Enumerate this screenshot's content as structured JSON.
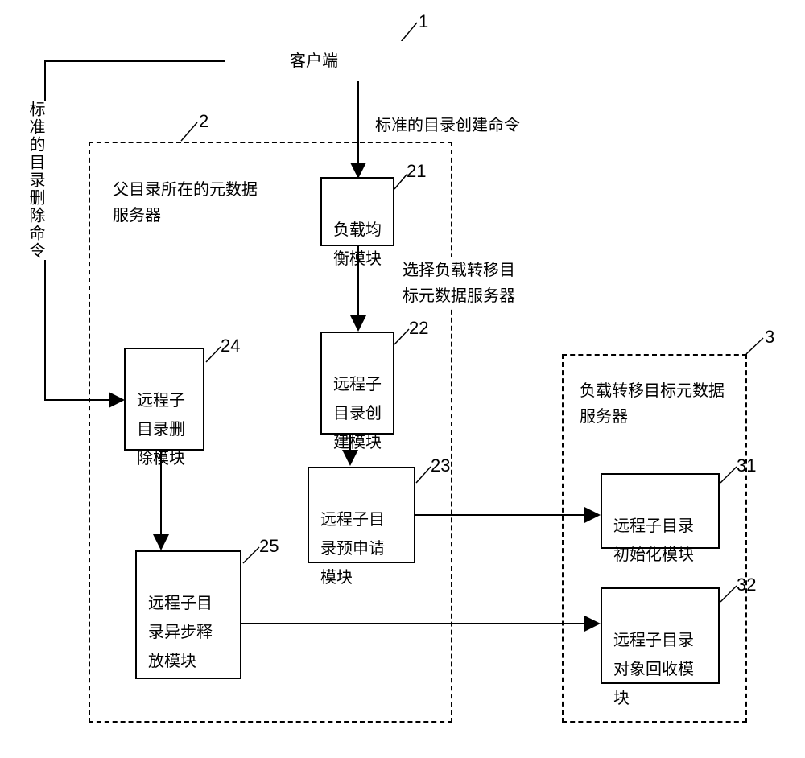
{
  "nodes": {
    "client": "客户端",
    "loadBalance": "负载均\n衡模块",
    "remoteCreate": "远程子\n目录创\n建模块",
    "remoteDelete": "远程子\n目录删\n除模块",
    "remotePreApply": "远程子目\n录预申请\n模块",
    "remoteAsyncRelease": "远程子目\n录异步释\n放模块",
    "remoteInit": "远程子目录\n初始化模块",
    "remoteRecycle": "远程子目录\n对象回收模\n块"
  },
  "containers": {
    "parentMetaServer": "父目录所在的元数据\n服务器",
    "targetMetaServer": "负载转移目标元数据\n服务器"
  },
  "edgeLabels": {
    "createCmd": "标准的目录创建命令",
    "deleteCmd": "标准的目录删除命令",
    "selectTarget": "选择负载转移目\n标元数据服务器"
  },
  "markers": {
    "n1": "1",
    "n2": "2",
    "n3": "3",
    "n21": "21",
    "n22": "22",
    "n23": "23",
    "n24": "24",
    "n25": "25",
    "n31": "31",
    "n32": "32"
  }
}
